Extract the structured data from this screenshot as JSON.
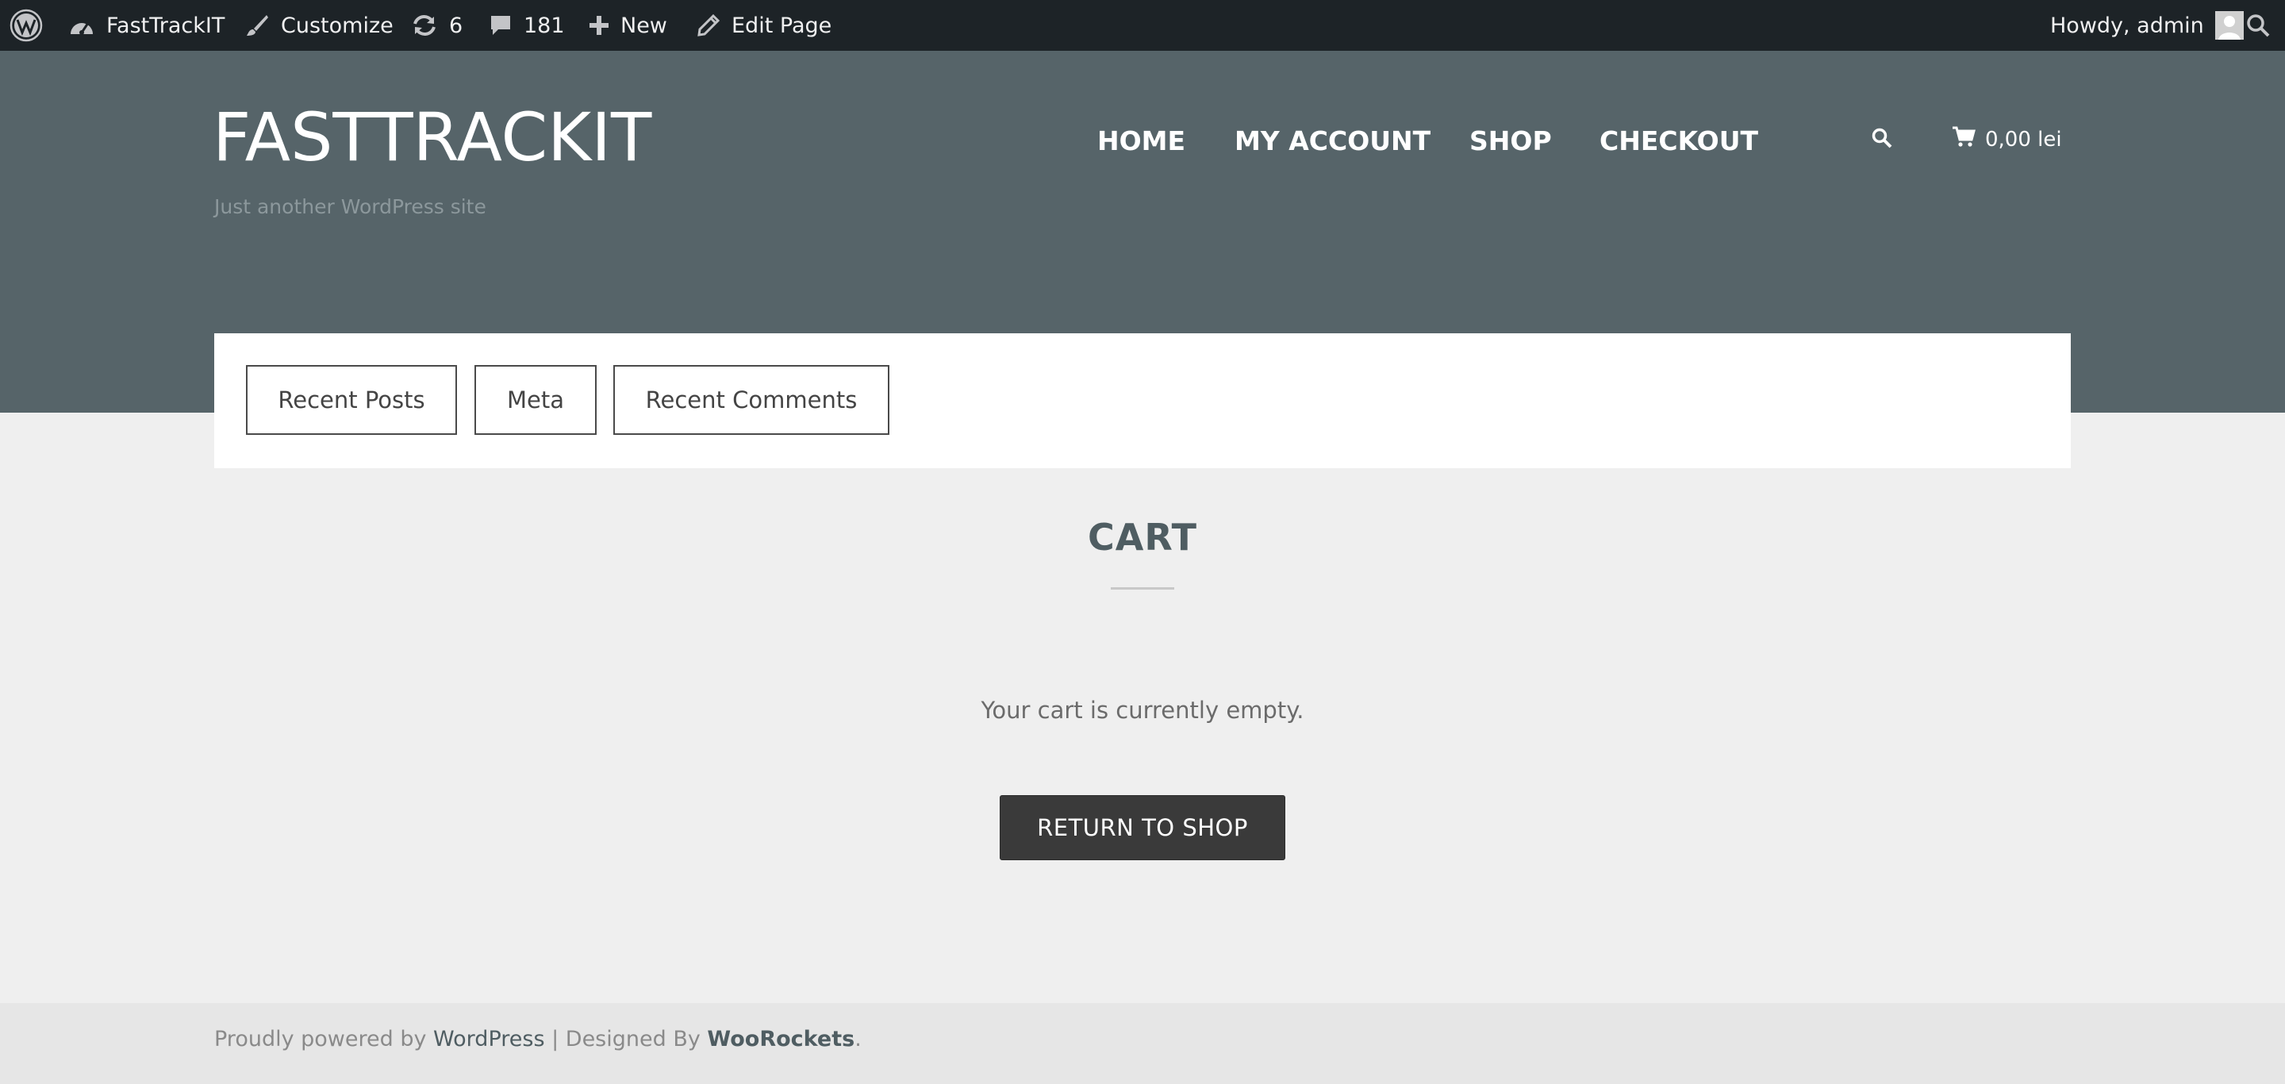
{
  "admin_bar": {
    "site_name": "FastTrackIT",
    "customize": "Customize",
    "updates_count": "6",
    "comments_count": "181",
    "new": "New",
    "edit_page": "Edit Page",
    "howdy": "Howdy, admin",
    "icons": [
      "wordpress-logo-icon",
      "dashboard-icon",
      "brush-icon",
      "updates-icon",
      "comments-icon",
      "plus-icon",
      "pencil-icon",
      "avatar",
      "search-icon"
    ]
  },
  "site": {
    "title": "FASTTRACKIT",
    "tagline": "Just another WordPress site"
  },
  "nav": {
    "items": [
      "HOME",
      "MY ACCOUNT",
      "SHOP",
      "CHECKOUT"
    ],
    "cart_total": "0,00 lei"
  },
  "widget_tabs": [
    "Recent Posts",
    "Meta",
    "Recent Comments"
  ],
  "main": {
    "title": "CART",
    "empty_message": "Your cart is currently empty.",
    "return_button": "RETURN TO SHOP"
  },
  "footer": {
    "powered_prefix": "Proudly powered by ",
    "powered_link": "WordPress",
    "separator": " | Designed By ",
    "designer_link": "WooRockets",
    "suffix": "."
  },
  "colors": {
    "admin_bar_bg": "#1d2327",
    "header_bg": "#566469",
    "page_bg": "#efefef",
    "button_bg": "#3a3a3a",
    "title_color": "#4f5d62"
  }
}
